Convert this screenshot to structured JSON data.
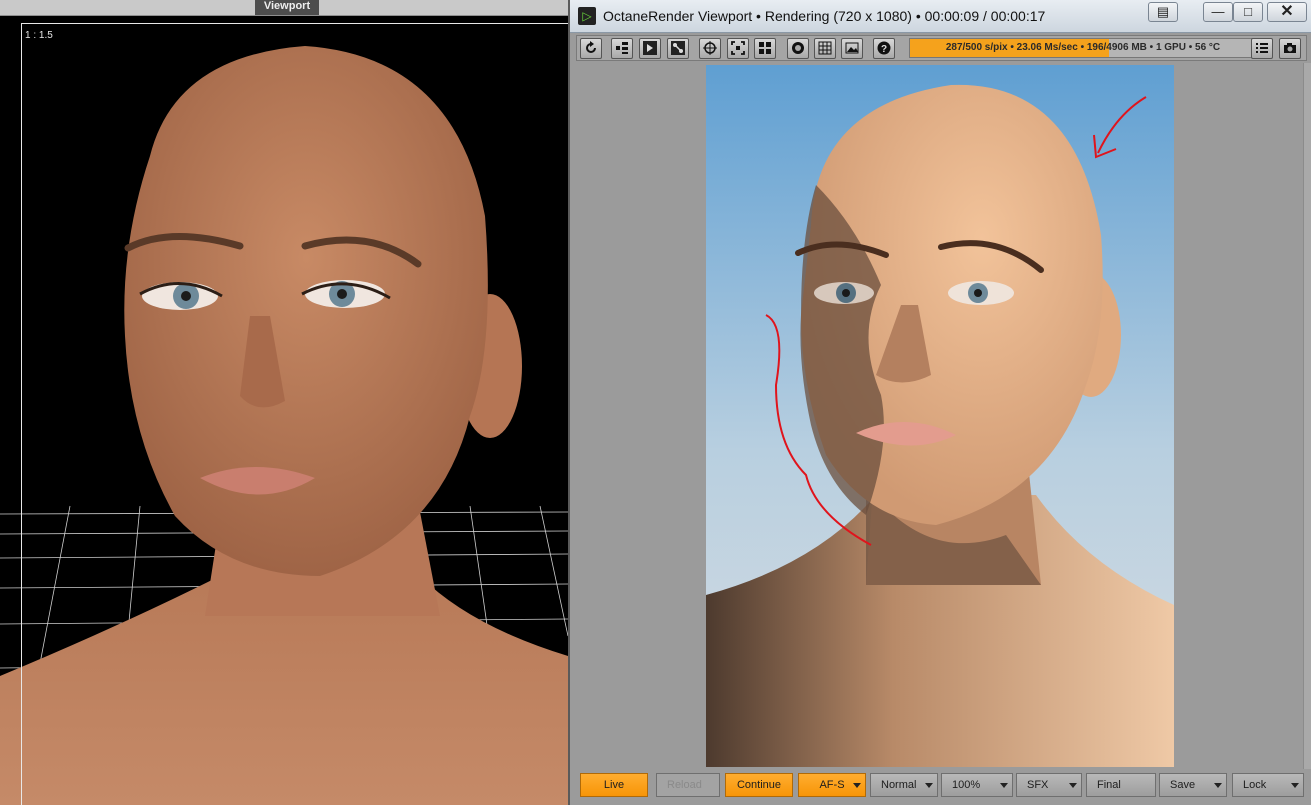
{
  "left_viewport": {
    "tab_label": "Viewport",
    "ratio_label": "1 : 1.5"
  },
  "octane": {
    "window_title": "OctaneRender Viewport • Rendering (720 x 1080) • 00:00:09 / 00:00:17",
    "status_text": "287/500 s/pix • 23.06 Ms/sec • 196/4906 MB • 1 GPU • 56 °C",
    "progress_fraction": 0.574,
    "window_buttons": [
      "restore-icon",
      "minimize-icon",
      "maximize-icon",
      "close-icon"
    ],
    "toolbar_icons": [
      "refresh-icon",
      "scene-tree-icon",
      "viewport-icon",
      "nodes-icon",
      "crosshair-icon",
      "focus-region-icon",
      "grid-view-icon",
      "record-icon",
      "region-grid-icon",
      "image-icon",
      "help-icon",
      "list-icon",
      "camera-icon"
    ],
    "bottom_buttons": [
      {
        "label": "Live",
        "style": "orange",
        "dropdown": false
      },
      {
        "label": "Reload",
        "style": "disabled",
        "dropdown": false
      },
      {
        "label": "Continue",
        "style": "orange",
        "dropdown": false
      },
      {
        "label": "AF-S",
        "style": "orange",
        "dropdown": true
      },
      {
        "label": "Normal",
        "style": "normal",
        "dropdown": true
      },
      {
        "label": "100%",
        "style": "normal",
        "dropdown": true
      },
      {
        "label": "SFX",
        "style": "normal",
        "dropdown": true
      },
      {
        "label": "Final",
        "style": "normal",
        "dropdown": false
      },
      {
        "label": "Save",
        "style": "normal",
        "dropdown": true
      },
      {
        "label": "Lock",
        "style": "normal",
        "dropdown": true
      }
    ]
  },
  "colors": {
    "accent_orange": "#f79507",
    "annotation_red": "#e0141c",
    "sky_top": "#5f9fd2",
    "sky_bottom": "#d7dde2"
  }
}
